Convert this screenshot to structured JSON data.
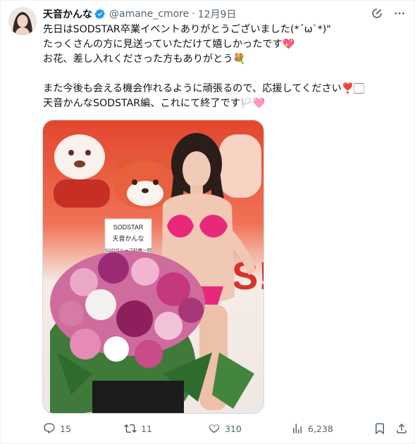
{
  "tweet": {
    "author_name": "天音かんな",
    "handle": "@amane_cmore",
    "separator": "·",
    "date": "12月9日",
    "text": "先日はSODSTAR卒業イベントありがとうございました(*´ω`*)\"\nたっくさんの方に見送っていただけて嬉しかったです💖\nお花、差し入れくださった方もありがとう💐\n\nまた今後も会える機会作れるように頑張るので、応援してください❣️🏻\n天音かんなSODSTAR編、これにて終了です🏳️🩷"
  },
  "photo": {
    "sign_lines": [
      "SODSTAR",
      "天音かんな",
      "SODグループ社員一同"
    ]
  },
  "actions": {
    "replies": "15",
    "reposts": "11",
    "likes": "310",
    "views": "6,238"
  },
  "icons": {
    "verified": "verified-badge-icon",
    "grok": "grok-icon",
    "more": "more-icon",
    "reply": "reply-icon",
    "repost": "repost-icon",
    "like": "like-icon",
    "views": "views-icon",
    "bookmark": "bookmark-icon",
    "share": "share-icon"
  },
  "colors": {
    "accent": "#1d9bf0",
    "text": "#0f1419",
    "secondary": "#536471"
  }
}
